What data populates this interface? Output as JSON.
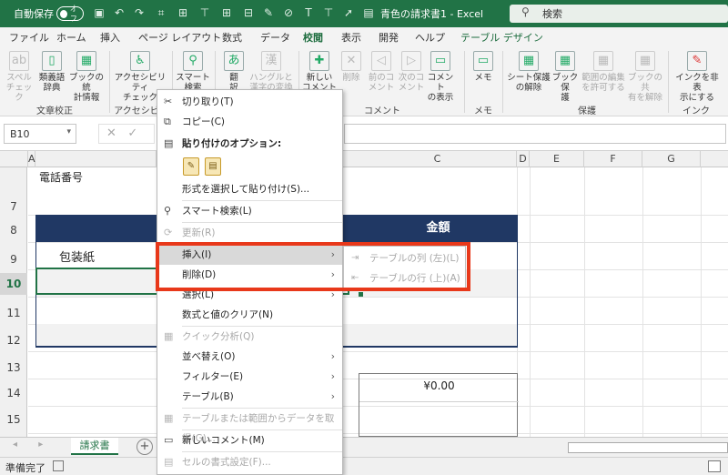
{
  "titlebar": {
    "autosave_label": "自動保存",
    "autosave_state": "オフ",
    "doc_title": "青色の請求書1 - Excel",
    "search_placeholder": "検索",
    "quick_access_icons": [
      "save-icon",
      "undo-icon",
      "redo-icon",
      "format-icon",
      "cursor-icon",
      "file-icon"
    ]
  },
  "menubar": {
    "tabs": [
      "ファイル",
      "ホーム",
      "挿入",
      "ページ レイアウト",
      "数式",
      "データ",
      "校閲",
      "表示",
      "開発",
      "ヘルプ",
      "テーブル デザイン"
    ],
    "active_tab": "校閲"
  },
  "ribbon": {
    "buttons": [
      {
        "label1": "スペル",
        "label2": "チェック",
        "icon": "abc-icon",
        "dim": true
      },
      {
        "label1": "類義語",
        "label2": "辞典",
        "icon": "book-icon",
        "dim": false
      },
      {
        "label1": "ブックの統",
        "label2": "計情報",
        "icon": "stats-icon",
        "dim": false
      },
      {
        "label1": "アクセシビリティ",
        "label2": "チェック",
        "icon": "accessibility-icon",
        "dim": false
      },
      {
        "label1": "スマート",
        "label2": "検索",
        "icon": "smart-lookup-icon",
        "dim": false
      },
      {
        "label1": "翻",
        "label2": "訳",
        "icon": "translate-icon",
        "dim": false
      },
      {
        "label1": "ハングルと",
        "label2": "漢字の変換",
        "icon": "hangul-icon",
        "dim": true
      },
      {
        "label1": "新しい",
        "label2": "コメント",
        "icon": "new-comment-icon",
        "dim": false
      },
      {
        "label1": "削除",
        "label2": "",
        "icon": "delete-comment-icon",
        "dim": true
      },
      {
        "label1": "前のコ",
        "label2": "メント",
        "icon": "prev-comment-icon",
        "dim": true
      },
      {
        "label1": "次のコ",
        "label2": "メント",
        "icon": "next-comment-icon",
        "dim": true
      },
      {
        "label1": "コメント",
        "label2": "の表示",
        "icon": "show-comments-icon",
        "dim": false
      },
      {
        "label1": "メモ",
        "label2": "",
        "icon": "memo-icon",
        "dim": false
      },
      {
        "label1": "シート保護",
        "label2": "の解除",
        "icon": "unprotect-sheet-icon",
        "dim": false
      },
      {
        "label1": "ブック保",
        "label2": "護",
        "icon": "protect-workbook-icon",
        "dim": false
      },
      {
        "label1": "範囲の編集",
        "label2": "を許可する",
        "icon": "allow-edit-icon",
        "dim": true
      },
      {
        "label1": "ブックの共",
        "label2": "有を解除",
        "icon": "unshare-icon",
        "dim": true
      },
      {
        "label1": "インクを非表",
        "label2": "示にする",
        "icon": "ink-icon",
        "dim": false
      }
    ],
    "groups": [
      "文章校正",
      "アクセシビリ",
      "コメント",
      "メモ",
      "保護",
      "インク"
    ]
  },
  "formula_bar": {
    "name_box": "B10",
    "cancel_symbol": "✕",
    "enter_symbol": "✓"
  },
  "columns": [
    "A",
    "C",
    "D",
    "E",
    "F",
    "G"
  ],
  "rows": [
    "7",
    "8",
    "9",
    "10",
    "11",
    "12",
    "13",
    "14",
    "15"
  ],
  "cells": {
    "phone_label": "電話番号",
    "amount_header": "金額",
    "wrapping_paper": "包装紙",
    "total": "¥0.00"
  },
  "context_menu": {
    "items": [
      {
        "label": "切り取り(T)",
        "icon": "cut-icon",
        "dim": false
      },
      {
        "label": "コピー(C)",
        "icon": "copy-icon",
        "dim": false
      },
      {
        "label": "貼り付けのオプション:",
        "icon": "paste-icon",
        "dim": false
      },
      {
        "label": "形式を選択して貼り付け(S)...",
        "icon": "",
        "dim": false
      },
      {
        "label": "スマート検索(L)",
        "icon": "search-icon",
        "dim": false
      },
      {
        "label": "更新(R)",
        "icon": "refresh-icon",
        "dim": true
      },
      {
        "label": "挿入(I)",
        "icon": "",
        "dim": false
      },
      {
        "label": "削除(D)",
        "icon": "",
        "dim": false
      },
      {
        "label": "選択(L)",
        "icon": "",
        "dim": false
      },
      {
        "label": "数式と値のクリア(N)",
        "icon": "",
        "dim": false
      },
      {
        "label": "クイック分析(Q)",
        "icon": "quick-analysis-icon",
        "dim": true
      },
      {
        "label": "並べ替え(O)",
        "icon": "",
        "dim": false
      },
      {
        "label": "フィルター(E)",
        "icon": "",
        "dim": false
      },
      {
        "label": "テーブル(B)",
        "icon": "",
        "dim": false
      },
      {
        "label": "テーブルまたは範囲からデータを取得(G)...",
        "icon": "table-data-icon",
        "dim": true
      },
      {
        "label": "新しいコメント(M)",
        "icon": "comment-icon",
        "dim": false
      },
      {
        "label": "セルの書式設定(F)...",
        "icon": "format-cells-icon",
        "dim": true
      }
    ],
    "submenu": [
      {
        "label": "テーブルの列 (左)(L)",
        "icon": "insert-column-icon"
      },
      {
        "label": "テーブルの行 (上)(A)",
        "icon": "insert-row-icon"
      }
    ]
  },
  "sheet": {
    "tab_name": "請求書",
    "add_symbol": "+"
  },
  "status": {
    "text": "準備完了"
  },
  "colors": {
    "excel_green": "#217346",
    "table_navy": "#203864",
    "highlight_red": "#e8381a"
  }
}
